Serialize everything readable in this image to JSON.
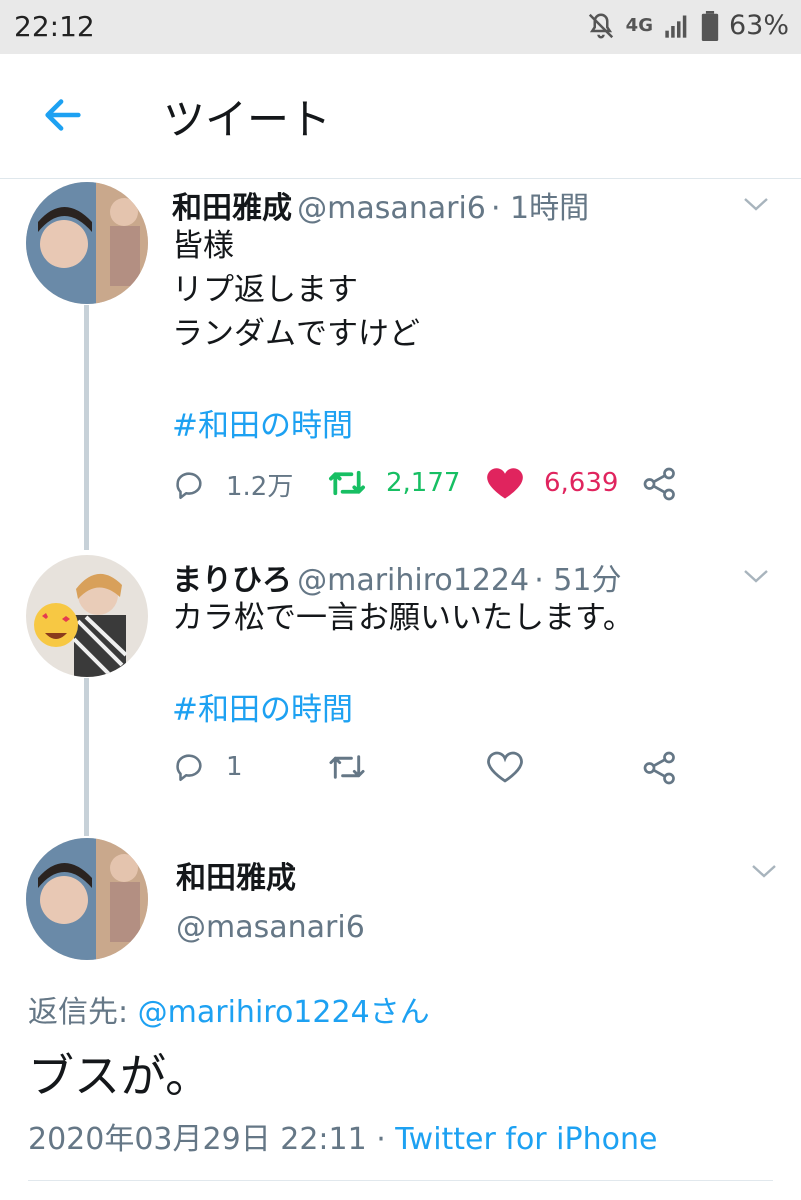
{
  "status": {
    "time": "22:12",
    "network": "4G",
    "battery": "63%"
  },
  "header": {
    "title": "ツイート"
  },
  "tweet1": {
    "name": "和田雅成",
    "handle": "@masanari6",
    "time": "· 1時間",
    "lines": [
      "皆様",
      "リプ返します",
      "ランダムですけど"
    ],
    "hashtag": "#和田の時間",
    "replies": "1.2万",
    "retweets": "2,177",
    "likes": "6,639"
  },
  "tweet2": {
    "name": "まりひろ",
    "handle": "@marihiro1224",
    "time": "· 51分",
    "text": "カラ松で一言お願いいたします。",
    "hashtag": "#和田の時間",
    "replies": "1"
  },
  "tweet3": {
    "name": "和田雅成",
    "handle": "@masanari6",
    "reply_prefix": "返信先: ",
    "reply_to": "@marihiro1224さん",
    "text": "ブスが。",
    "timestamp": "2020年03月29日 22:11",
    "separator": " · ",
    "source": "Twitter for iPhone"
  },
  "colors": {
    "accent": "#1da1f2",
    "retweet": "#17bf63",
    "like": "#e0245e",
    "muted": "#657786"
  }
}
